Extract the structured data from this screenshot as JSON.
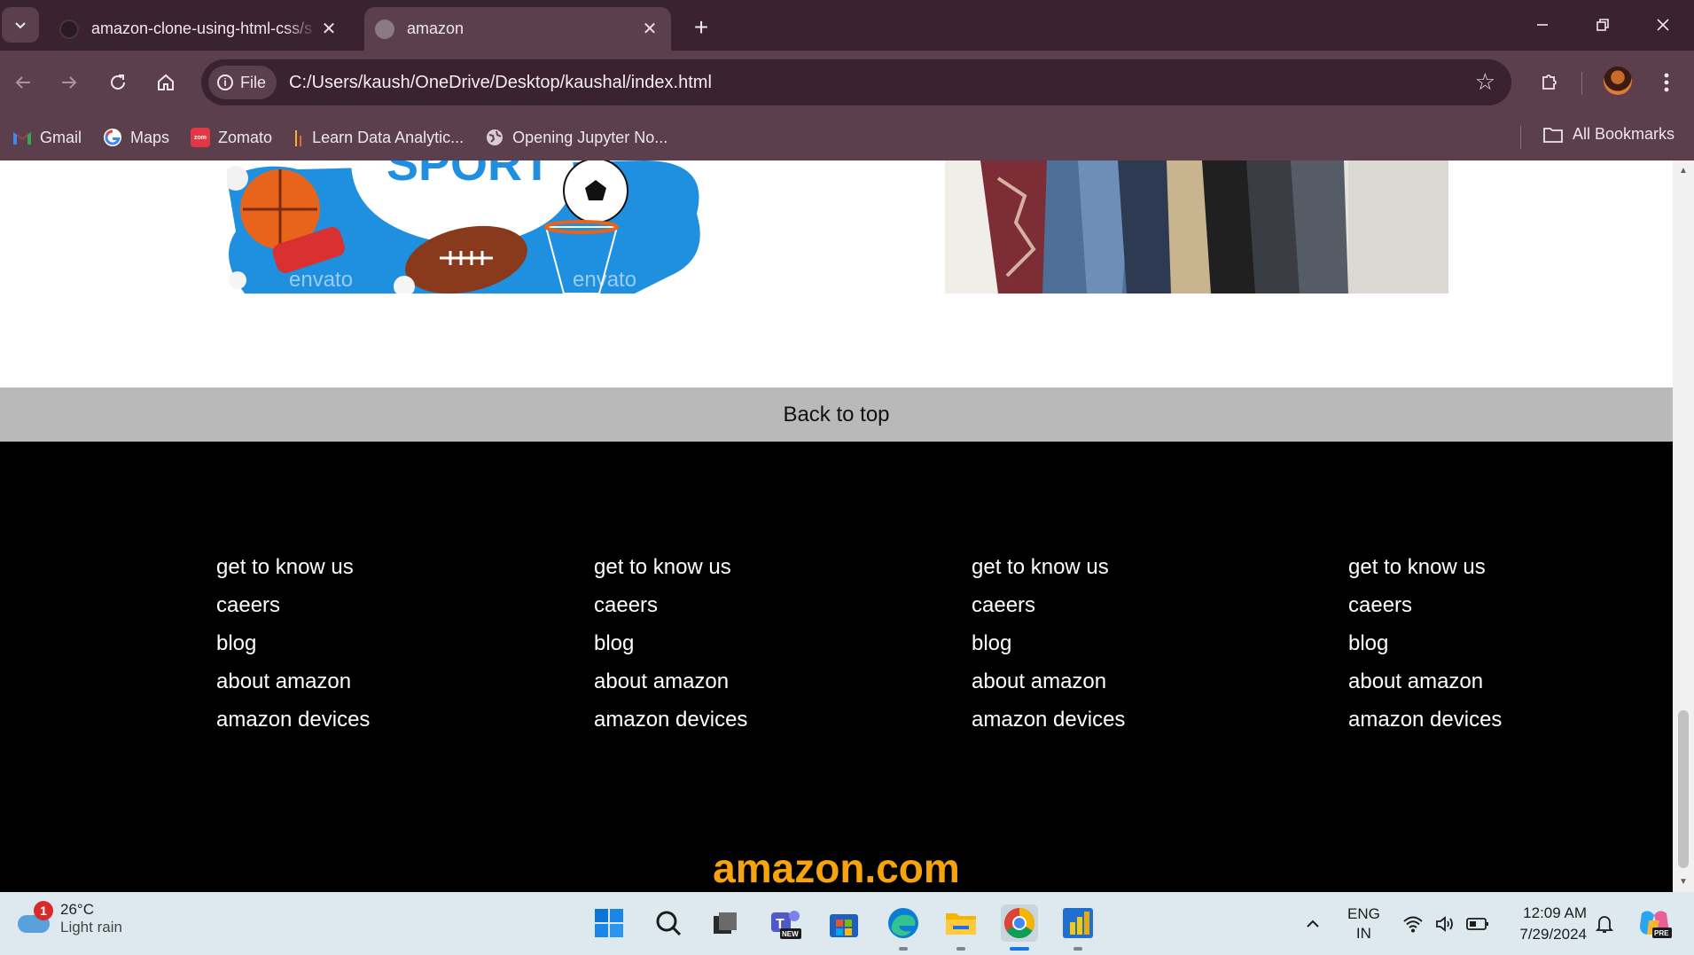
{
  "browser": {
    "tabs": [
      {
        "title": "amazon-clone-using-html-css/s",
        "active": false
      },
      {
        "title": "amazon",
        "active": true
      }
    ],
    "new_tab_label": "+",
    "address": {
      "scheme_chip": "File",
      "url": "C:/Users/kaush/OneDrive/Desktop/kaushal/index.html"
    },
    "bookmarks": [
      {
        "label": "Gmail",
        "icon": "gmail-icon"
      },
      {
        "label": "Maps",
        "icon": "google-icon"
      },
      {
        "label": "Zomato",
        "icon": "zomato-icon"
      },
      {
        "label": "Learn Data Analytic...",
        "icon": "analytics-icon"
      },
      {
        "label": "Opening Jupyter No...",
        "icon": "globe-icon"
      }
    ],
    "all_bookmarks_label": "All Bookmarks"
  },
  "page": {
    "back_to_top": "Back to top",
    "footer_columns": [
      {
        "links": [
          "get to know us",
          "caeers",
          "blog",
          "about amazon",
          "amazon devices"
        ]
      },
      {
        "links": [
          "get to know us",
          "caeers",
          "blog",
          "about amazon",
          "amazon devices"
        ]
      },
      {
        "links": [
          "get to know us",
          "caeers",
          "blog",
          "about amazon",
          "amazon devices"
        ]
      },
      {
        "links": [
          "get to know us",
          "caeers",
          "blog",
          "about amazon",
          "amazon devices"
        ]
      }
    ],
    "brand": "amazon.com",
    "brand_color": "#f7a30e",
    "image_watermark": "envato"
  },
  "taskbar": {
    "weather": {
      "temp": "26°C",
      "desc": "Light rain",
      "badge": "1"
    },
    "language": {
      "line1": "ENG",
      "line2": "IN"
    },
    "clock": {
      "time": "12:09 AM",
      "date": "7/29/2024"
    },
    "teams_badge": "NEW",
    "copilot_badge": "PRE"
  },
  "colors": {
    "chrome_dark": "#3a2230",
    "chrome_mid": "#5b3f4d",
    "footer_bg": "#000000",
    "back_to_top_bg": "#b9b9b9",
    "taskbar_bg": "#dde9ee"
  }
}
